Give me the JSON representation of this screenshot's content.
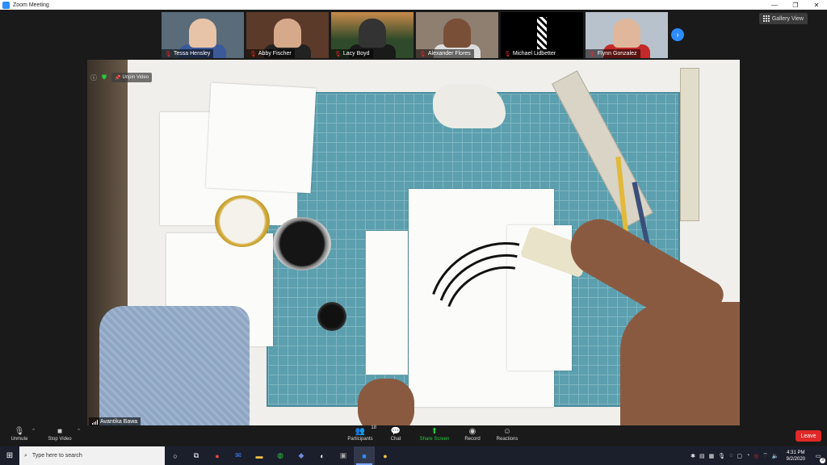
{
  "window": {
    "title": "Zoom Meeting",
    "minimize": "—",
    "restore": "❐",
    "close": "✕"
  },
  "gallery": {
    "label": "Gallery View"
  },
  "participants_strip": [
    {
      "name": "Tessa Hensley",
      "bg": "#5a6b7a",
      "skin": "#e7c4a8",
      "shirt": "#3c5a9a"
    },
    {
      "name": "Abby Fischer",
      "bg": "#5c3a2a",
      "skin": "#d6a98a",
      "shirt": "#222222"
    },
    {
      "name": "Lacy Boyd",
      "bg": "#2f4a2a",
      "skin": "#333333",
      "shirt": "#1a1a1a"
    },
    {
      "name": "Alexander Flores",
      "bg": "#8f7f70",
      "skin": "#7a4f38",
      "shirt": "#dddddd"
    },
    {
      "name": "Michael Lidbetter",
      "bg": "#000000",
      "skin": "#ffffff",
      "shirt": "#000000"
    },
    {
      "name": "Flynn Gonzalez",
      "bg": "#b8c2cc",
      "skin": "#e0b79a",
      "shirt": "#c42a2a"
    }
  ],
  "main_video": {
    "unpin_label": "Unpin Video",
    "speaker_name": "Avantika Bawa"
  },
  "toolbar": {
    "unmute": "Unmute",
    "stop_video": "Stop Video",
    "participants": "Participants",
    "participants_count": "18",
    "chat": "Chat",
    "share_screen": "Share Screen",
    "record": "Record",
    "reactions": "Reactions",
    "leave": "Leave"
  },
  "taskbar": {
    "search_placeholder": "Type here to search",
    "time": "4:31 PM",
    "date": "9/2/2020",
    "notifications": "3"
  },
  "colors": {
    "zoom_blue": "#2d8cff",
    "leave_red": "#e02828",
    "share_green": "#27c93f"
  }
}
